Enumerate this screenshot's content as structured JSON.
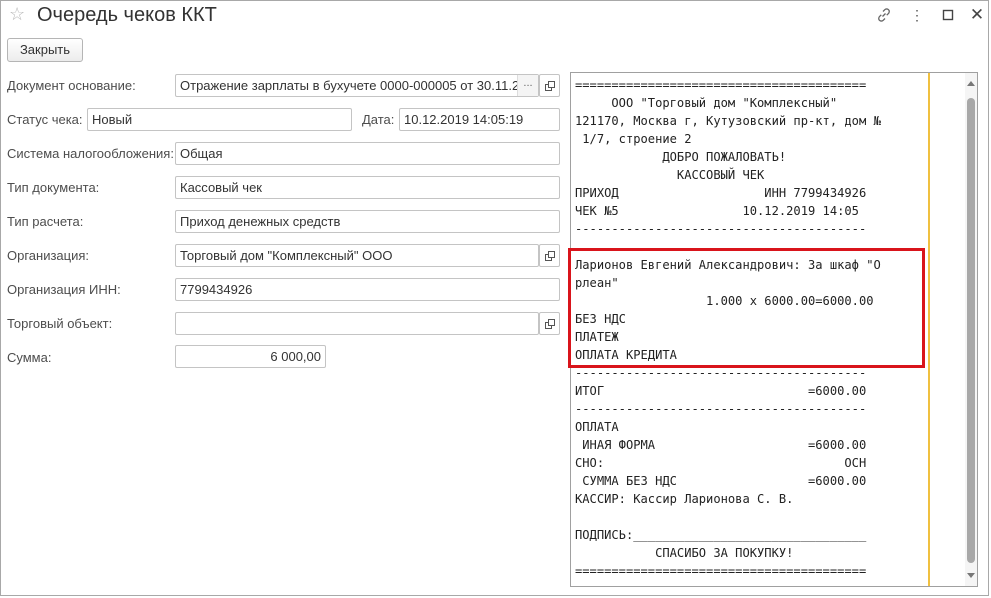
{
  "window": {
    "title": "Очередь чеков ККТ",
    "more_glyph": "⋮",
    "close_glyph": "✕",
    "star_glyph": "☆"
  },
  "toolbar": {
    "close_label": "Закрыть"
  },
  "form": {
    "doc_basis_label": "Документ основание:",
    "doc_basis_value": "Отражение зарплаты в бухучете 0000-000005 от 30.11.2",
    "ellipsis": "...",
    "status_label": "Статус чека:",
    "status_value": "Новый",
    "date_label": "Дата:",
    "date_value": "10.12.2019 14:05:19",
    "tax_label": "Система налогообложения:",
    "tax_value": "Общая",
    "doc_type_label": "Тип документа:",
    "doc_type_value": "Кассовый чек",
    "calc_type_label": "Тип расчета:",
    "calc_type_value": "Приход денежных средств",
    "org_label": "Организация:",
    "org_value": "Торговый дом \"Комплексный\" ООО",
    "inn_label": "Организация ИНН:",
    "inn_value": "7799434926",
    "trade_object_label": "Торговый объект:",
    "trade_object_value": "",
    "sum_label": "Сумма:",
    "sum_value": "6 000,00"
  },
  "receipt": {
    "lines": [
      "========================================",
      "     ООО \"Торговый дом \"Комплексный\"",
      "121170, Москва г, Кутузовский пр-кт, дом №",
      " 1/7, строение 2",
      "            ДОБРО ПОЖАЛОВАТЬ!",
      "              КАССОВЫЙ ЧЕК",
      "ПРИХОД                    ИНН 7799434926",
      "ЧЕК №5                 10.12.2019 14:05",
      "----------------------------------------",
      "",
      "Ларионов Евгений Александрович: За шкаф \"О",
      "рлеан\"",
      "                  1.000 x 6000.00=6000.00",
      "БЕЗ НДС",
      "ПЛАТЕЖ",
      "ОПЛАТА КРЕДИТА",
      "----------------------------------------",
      "ИТОГ                            =6000.00",
      "----------------------------------------",
      "ОПЛАТА",
      " ИНАЯ ФОРМА                     =6000.00",
      "СНО:                                 ОСН",
      " СУММА БЕЗ НДС                  =6000.00",
      "КАССИР: Кассир Ларионова С. В.",
      "",
      "ПОДПИСЬ:________________________________",
      "           СПАСИБО ЗА ПОКУПКУ!",
      "========================================"
    ]
  },
  "colors": {
    "highlight": "#d9141b",
    "margin_line": "#f0c040"
  }
}
